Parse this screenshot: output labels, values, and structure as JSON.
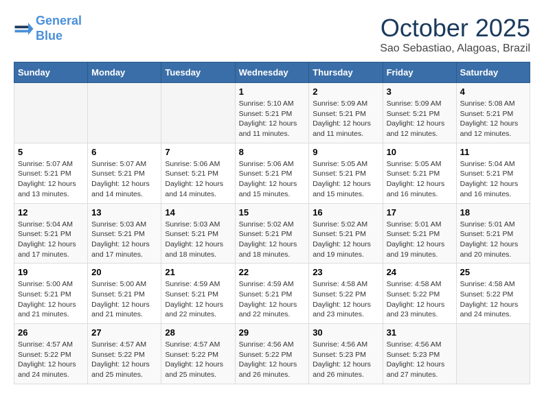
{
  "header": {
    "logo_line1": "General",
    "logo_line2": "Blue",
    "month": "October 2025",
    "location": "Sao Sebastiao, Alagoas, Brazil"
  },
  "weekdays": [
    "Sunday",
    "Monday",
    "Tuesday",
    "Wednesday",
    "Thursday",
    "Friday",
    "Saturday"
  ],
  "weeks": [
    [
      {
        "day": "",
        "info": ""
      },
      {
        "day": "",
        "info": ""
      },
      {
        "day": "",
        "info": ""
      },
      {
        "day": "1",
        "info": "Sunrise: 5:10 AM\nSunset: 5:21 PM\nDaylight: 12 hours and 11 minutes."
      },
      {
        "day": "2",
        "info": "Sunrise: 5:09 AM\nSunset: 5:21 PM\nDaylight: 12 hours and 11 minutes."
      },
      {
        "day": "3",
        "info": "Sunrise: 5:09 AM\nSunset: 5:21 PM\nDaylight: 12 hours and 12 minutes."
      },
      {
        "day": "4",
        "info": "Sunrise: 5:08 AM\nSunset: 5:21 PM\nDaylight: 12 hours and 12 minutes."
      }
    ],
    [
      {
        "day": "5",
        "info": "Sunrise: 5:07 AM\nSunset: 5:21 PM\nDaylight: 12 hours and 13 minutes."
      },
      {
        "day": "6",
        "info": "Sunrise: 5:07 AM\nSunset: 5:21 PM\nDaylight: 12 hours and 14 minutes."
      },
      {
        "day": "7",
        "info": "Sunrise: 5:06 AM\nSunset: 5:21 PM\nDaylight: 12 hours and 14 minutes."
      },
      {
        "day": "8",
        "info": "Sunrise: 5:06 AM\nSunset: 5:21 PM\nDaylight: 12 hours and 15 minutes."
      },
      {
        "day": "9",
        "info": "Sunrise: 5:05 AM\nSunset: 5:21 PM\nDaylight: 12 hours and 15 minutes."
      },
      {
        "day": "10",
        "info": "Sunrise: 5:05 AM\nSunset: 5:21 PM\nDaylight: 12 hours and 16 minutes."
      },
      {
        "day": "11",
        "info": "Sunrise: 5:04 AM\nSunset: 5:21 PM\nDaylight: 12 hours and 16 minutes."
      }
    ],
    [
      {
        "day": "12",
        "info": "Sunrise: 5:04 AM\nSunset: 5:21 PM\nDaylight: 12 hours and 17 minutes."
      },
      {
        "day": "13",
        "info": "Sunrise: 5:03 AM\nSunset: 5:21 PM\nDaylight: 12 hours and 17 minutes."
      },
      {
        "day": "14",
        "info": "Sunrise: 5:03 AM\nSunset: 5:21 PM\nDaylight: 12 hours and 18 minutes."
      },
      {
        "day": "15",
        "info": "Sunrise: 5:02 AM\nSunset: 5:21 PM\nDaylight: 12 hours and 18 minutes."
      },
      {
        "day": "16",
        "info": "Sunrise: 5:02 AM\nSunset: 5:21 PM\nDaylight: 12 hours and 19 minutes."
      },
      {
        "day": "17",
        "info": "Sunrise: 5:01 AM\nSunset: 5:21 PM\nDaylight: 12 hours and 19 minutes."
      },
      {
        "day": "18",
        "info": "Sunrise: 5:01 AM\nSunset: 5:21 PM\nDaylight: 12 hours and 20 minutes."
      }
    ],
    [
      {
        "day": "19",
        "info": "Sunrise: 5:00 AM\nSunset: 5:21 PM\nDaylight: 12 hours and 21 minutes."
      },
      {
        "day": "20",
        "info": "Sunrise: 5:00 AM\nSunset: 5:21 PM\nDaylight: 12 hours and 21 minutes."
      },
      {
        "day": "21",
        "info": "Sunrise: 4:59 AM\nSunset: 5:21 PM\nDaylight: 12 hours and 22 minutes."
      },
      {
        "day": "22",
        "info": "Sunrise: 4:59 AM\nSunset: 5:21 PM\nDaylight: 12 hours and 22 minutes."
      },
      {
        "day": "23",
        "info": "Sunrise: 4:58 AM\nSunset: 5:22 PM\nDaylight: 12 hours and 23 minutes."
      },
      {
        "day": "24",
        "info": "Sunrise: 4:58 AM\nSunset: 5:22 PM\nDaylight: 12 hours and 23 minutes."
      },
      {
        "day": "25",
        "info": "Sunrise: 4:58 AM\nSunset: 5:22 PM\nDaylight: 12 hours and 24 minutes."
      }
    ],
    [
      {
        "day": "26",
        "info": "Sunrise: 4:57 AM\nSunset: 5:22 PM\nDaylight: 12 hours and 24 minutes."
      },
      {
        "day": "27",
        "info": "Sunrise: 4:57 AM\nSunset: 5:22 PM\nDaylight: 12 hours and 25 minutes."
      },
      {
        "day": "28",
        "info": "Sunrise: 4:57 AM\nSunset: 5:22 PM\nDaylight: 12 hours and 25 minutes."
      },
      {
        "day": "29",
        "info": "Sunrise: 4:56 AM\nSunset: 5:22 PM\nDaylight: 12 hours and 26 minutes."
      },
      {
        "day": "30",
        "info": "Sunrise: 4:56 AM\nSunset: 5:23 PM\nDaylight: 12 hours and 26 minutes."
      },
      {
        "day": "31",
        "info": "Sunrise: 4:56 AM\nSunset: 5:23 PM\nDaylight: 12 hours and 27 minutes."
      },
      {
        "day": "",
        "info": ""
      }
    ]
  ]
}
